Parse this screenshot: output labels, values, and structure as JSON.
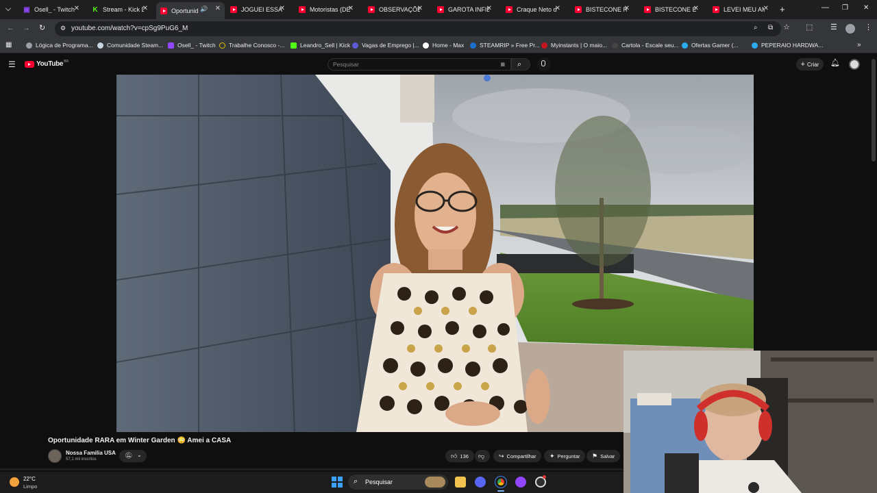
{
  "tabs": [
    {
      "title": "Osell_ - Twitch",
      "icon": "twitch-icon"
    },
    {
      "title": "Stream - Kick D",
      "icon": "kick-icon"
    },
    {
      "title": "Oportunid",
      "icon": "youtube-icon",
      "active": true
    },
    {
      "title": "JOGUEI ESSA P",
      "icon": "youtube-icon"
    },
    {
      "title": "Motoristas (DE",
      "icon": "youtube-icon"
    },
    {
      "title": "OBSERVAÇÕES",
      "icon": "youtube-icon"
    },
    {
      "title": "GAROTA INFIE",
      "icon": "youtube-icon"
    },
    {
      "title": "Craque Neto d",
      "icon": "youtube-icon"
    },
    {
      "title": "BISTECONE RE",
      "icon": "youtube-icon"
    },
    {
      "title": "BISTECONE E C",
      "icon": "youtube-icon"
    },
    {
      "title": "LEVEI MEU AM",
      "icon": "youtube-icon"
    }
  ],
  "address": {
    "url": "youtube.com/watch?v=cpSg9PuG6_M"
  },
  "bookmarks": [
    "Lógica de Programa...",
    "Comunidade Steam...",
    "Osell_ - Twitch",
    "Trabalhe Conosco -...",
    "Leandro_Sell | Kick",
    "Vagas de Emprego |...",
    "Home - Max",
    "STEAMRIP » Free Pr...",
    "Myinstants | O maio...",
    "Cartola - Escale seu...",
    "Ofertas Gamer (...",
    "PEPERAIO HARDWA..."
  ],
  "youtube": {
    "logo": "YouTube",
    "region": "BR",
    "search_placeholder": "Pesquisar",
    "create_label": "Criar",
    "video_title": "Oportunidade RARA em Winter Garden 😳 Amei a CASA",
    "channel_name": "Nossa Familia USA",
    "subscribers": "57,1 mil inscritos",
    "likes": "136",
    "share_label": "Compartilhar",
    "ask_label": "Perguntar",
    "save_label": "Salvar"
  },
  "taskbar": {
    "temperature": "22°C",
    "weather": "Limpo",
    "search_label": "Pesquisar"
  },
  "colors": {
    "accent": "#ff0033",
    "tab_bg": "#1f1f1f",
    "toolbar_bg": "#35363a",
    "page_bg": "#0f0f0f"
  }
}
